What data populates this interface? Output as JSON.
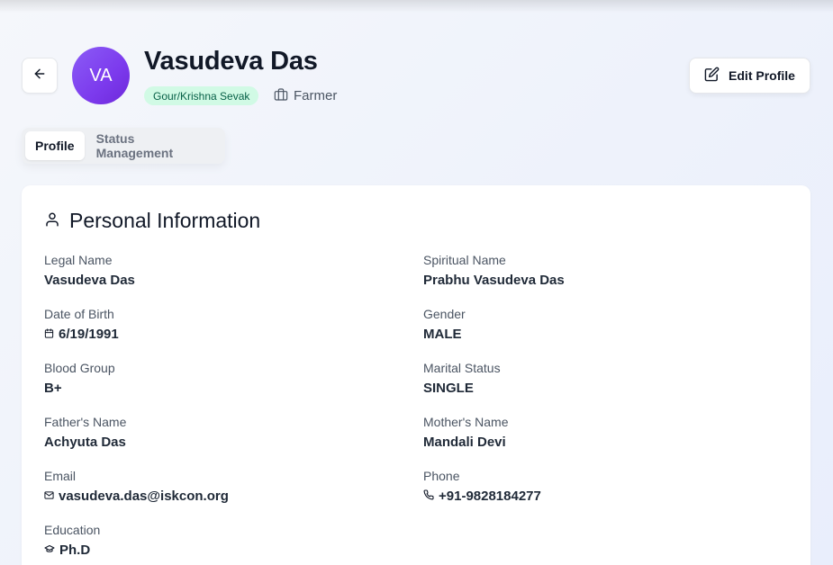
{
  "profile": {
    "initials": "VA",
    "name": "Vasudeva Das",
    "role": "Gour/Krishna Sevak",
    "occupation": "Farmer"
  },
  "header": {
    "edit_label": "Edit Profile"
  },
  "tabs": [
    {
      "label": "Profile",
      "active": true
    },
    {
      "label": "Status Management",
      "active": false
    }
  ],
  "personal_info": {
    "title": "Personal Information",
    "legal_name": {
      "label": "Legal Name",
      "value": "Vasudeva Das"
    },
    "spiritual_name": {
      "label": "Spiritual Name",
      "value": "Prabhu Vasudeva Das"
    },
    "dob": {
      "label": "Date of Birth",
      "value": "6/19/1991"
    },
    "gender": {
      "label": "Gender",
      "value": "MALE"
    },
    "blood_group": {
      "label": "Blood Group",
      "value": "B+"
    },
    "marital_status": {
      "label": "Marital Status",
      "value": "SINGLE"
    },
    "father": {
      "label": "Father's Name",
      "value": "Achyuta Das"
    },
    "mother": {
      "label": "Mother's Name",
      "value": "Mandali Devi"
    },
    "email": {
      "label": "Email",
      "value": "vasudeva.das@iskcon.org"
    },
    "phone": {
      "label": "Phone",
      "value": "+91-9828184277"
    },
    "education": {
      "label": "Education",
      "value": "Ph.D"
    }
  },
  "colors": {
    "avatar": "#7c3aed",
    "role_badge_bg": "#d1fae5",
    "role_badge_text": "#065f46"
  }
}
